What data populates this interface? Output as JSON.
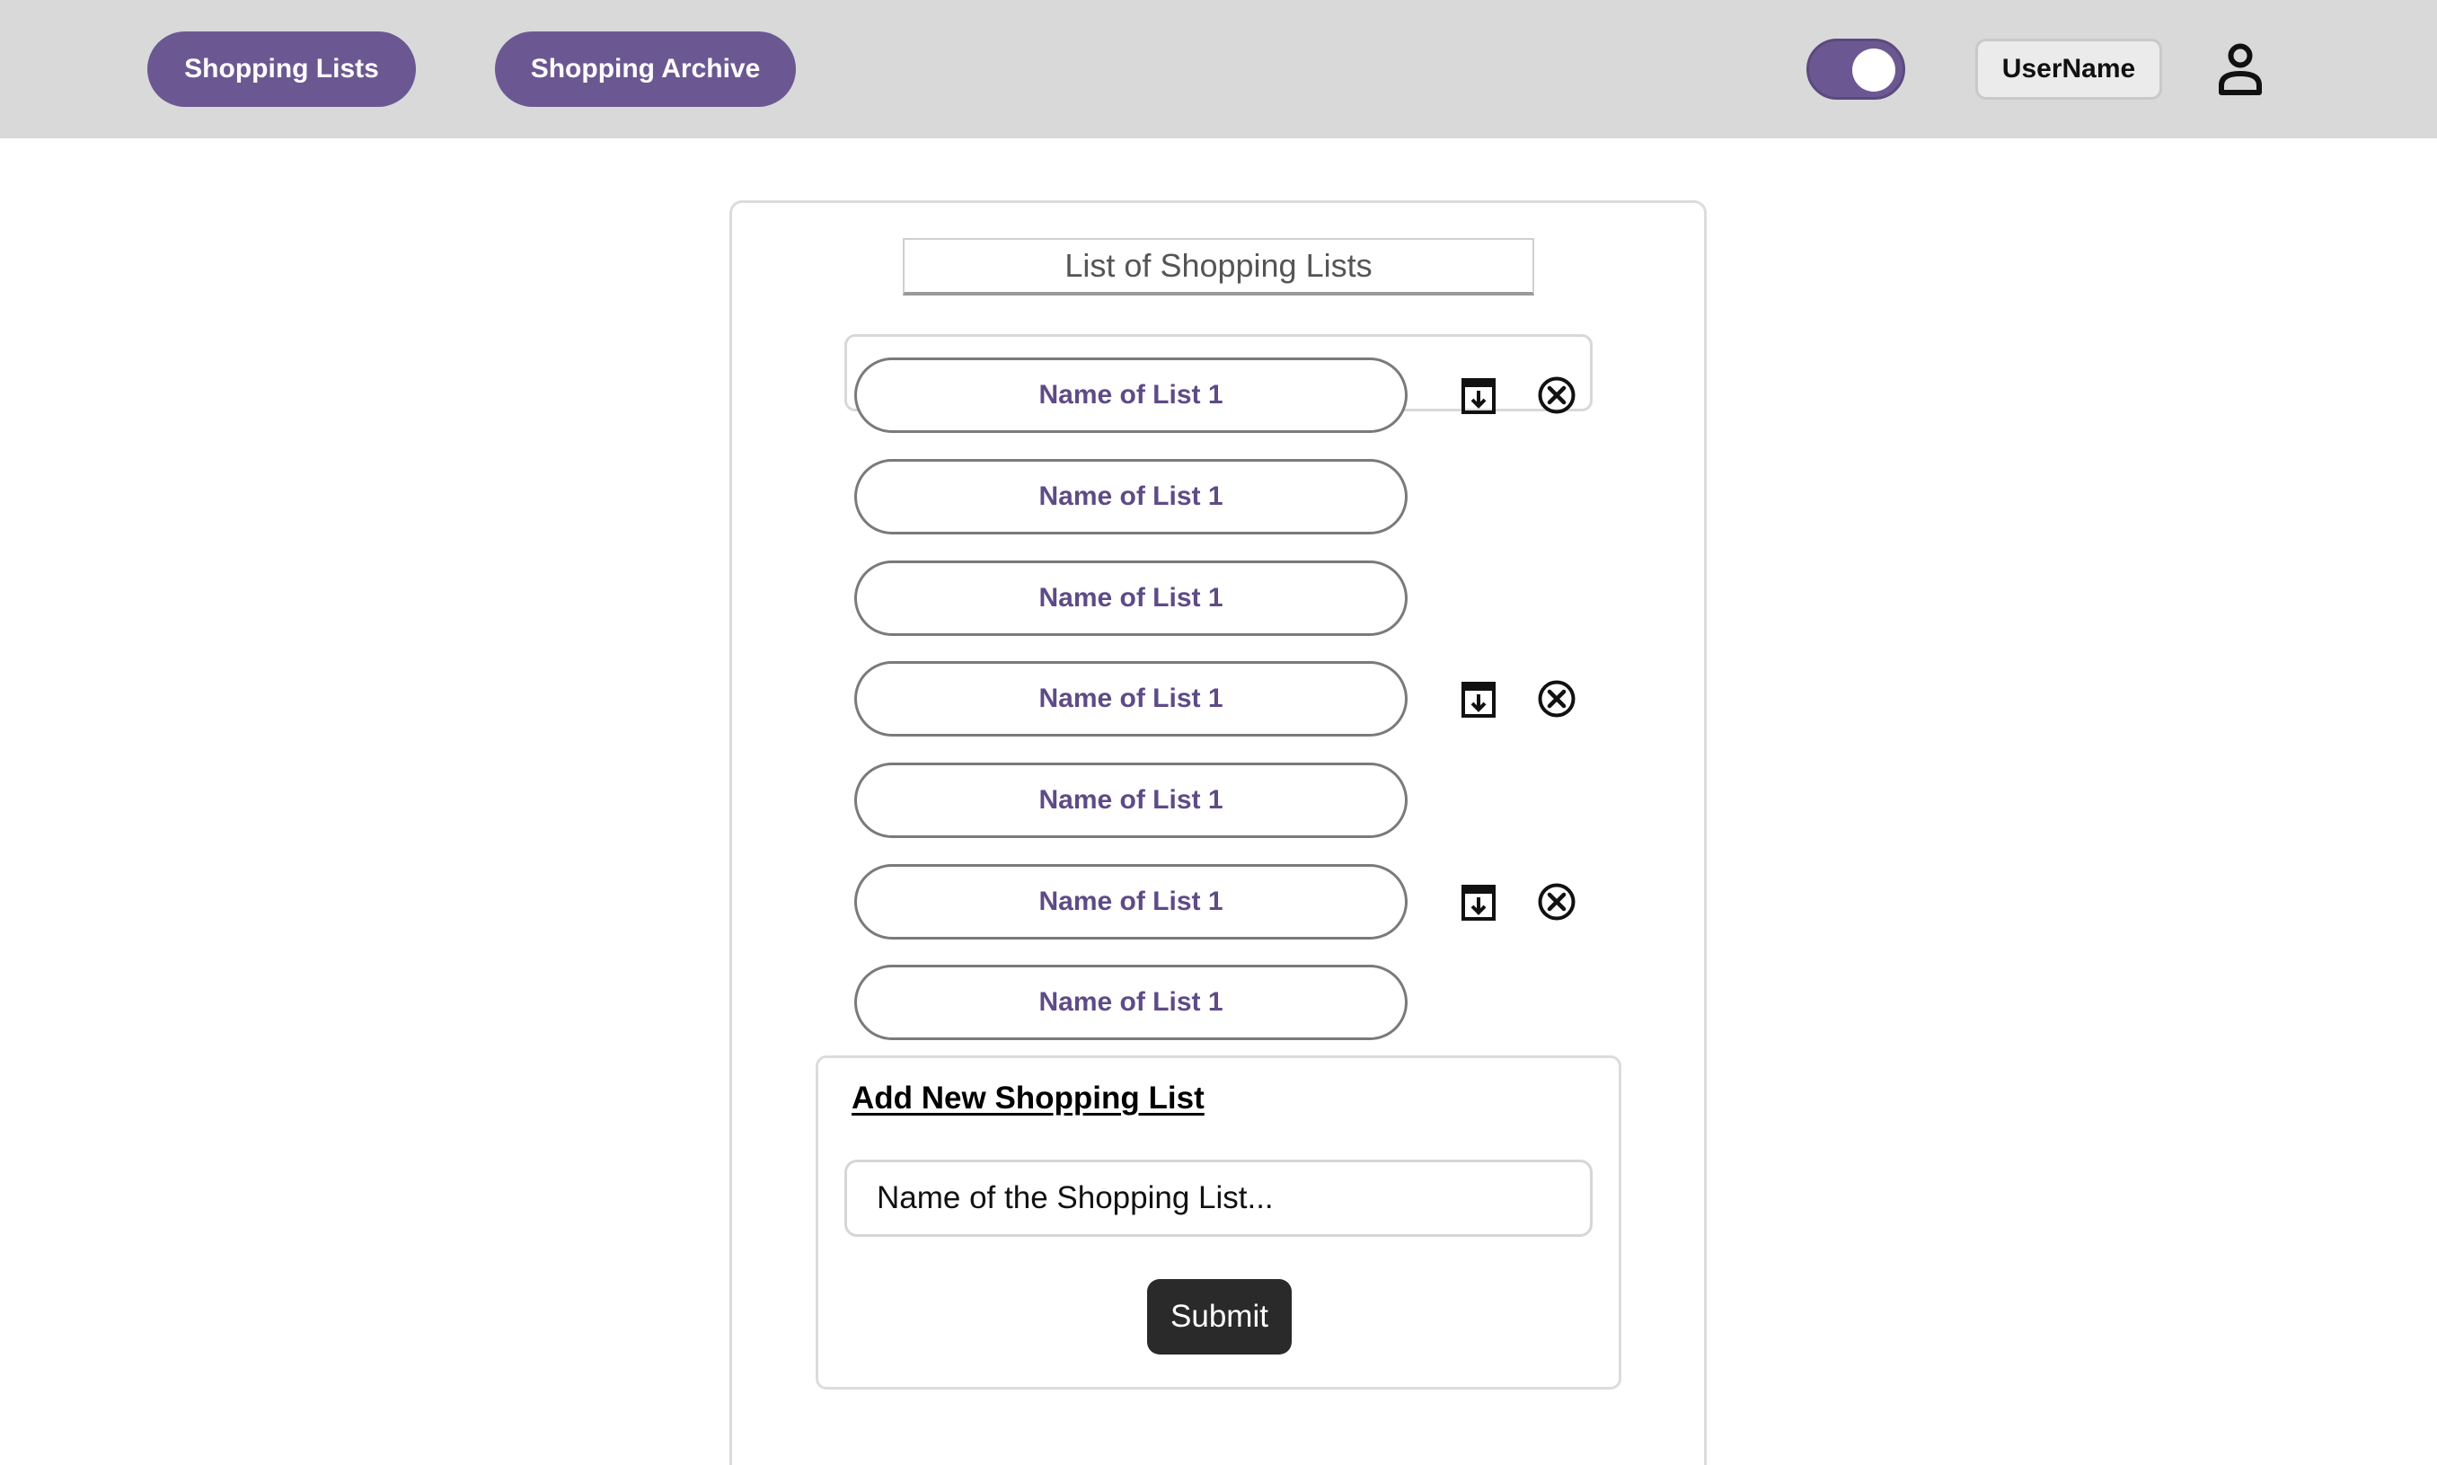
{
  "nav": {
    "shopping_lists_label": "Shopping Lists",
    "shopping_archive_label": "Shopping Archive"
  },
  "header": {
    "toggle_on": true,
    "username_label": "UserName",
    "user_icon": "user-icon"
  },
  "main": {
    "title": "List of Shopping Lists",
    "lists": [
      {
        "label": "Name of List 1",
        "has_actions": true
      },
      {
        "label": "Name of List 1",
        "has_actions": false
      },
      {
        "label": "Name of List 1",
        "has_actions": false
      },
      {
        "label": "Name of List 1",
        "has_actions": true
      },
      {
        "label": "Name of List 1",
        "has_actions": false
      },
      {
        "label": "Name of List 1",
        "has_actions": true
      },
      {
        "label": "Name of List 1",
        "has_actions": false
      }
    ],
    "row_action_icons": [
      "archive-icon",
      "close-circle-icon"
    ]
  },
  "add_form": {
    "title": "Add New Shopping List",
    "input_placeholder": "Name of the Shopping List...",
    "input_value": "",
    "submit_label": "Submit"
  },
  "colors": {
    "accent": "#6b5892",
    "topbar_bg": "#d9d9d9",
    "list_text": "#5e4b86",
    "submit_bg": "#2a2a2a"
  }
}
